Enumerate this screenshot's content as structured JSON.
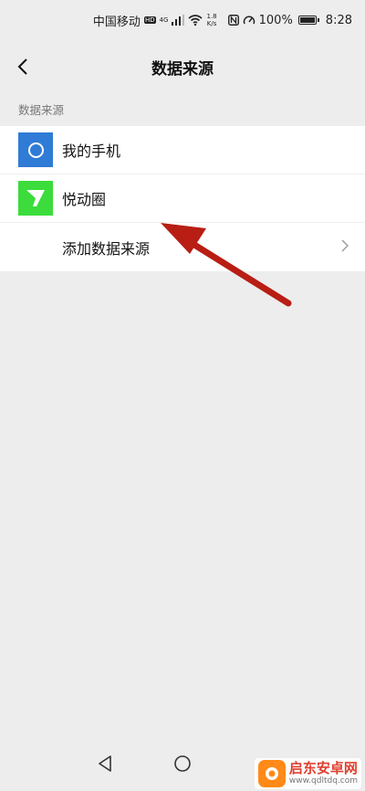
{
  "status_bar": {
    "carrier": "中国移动",
    "hd_badge": "HD",
    "network": "4G",
    "speed_value": "1.8",
    "speed_unit": "K/s",
    "battery": "100%",
    "time": "8:28"
  },
  "header": {
    "back_icon": "chevron-left-icon",
    "title": "数据来源"
  },
  "section": {
    "label": "数据来源"
  },
  "sources": [
    {
      "label": "我的手机",
      "icon": "phone-circle-icon",
      "color": "#2f7bd6"
    },
    {
      "label": "悦动圈",
      "icon": "yuedong-logo-icon",
      "color": "#3bdc3b"
    }
  ],
  "add_source": {
    "label": "添加数据来源",
    "icon": "chevron-right-icon"
  },
  "annotation": {
    "arrow_color": "#b81e14"
  },
  "system_nav": {
    "back": "triangle-back-icon",
    "home": "circle-home-icon"
  },
  "watermark": {
    "name": "启东安卓网",
    "url": "www.qdltdq.com"
  }
}
